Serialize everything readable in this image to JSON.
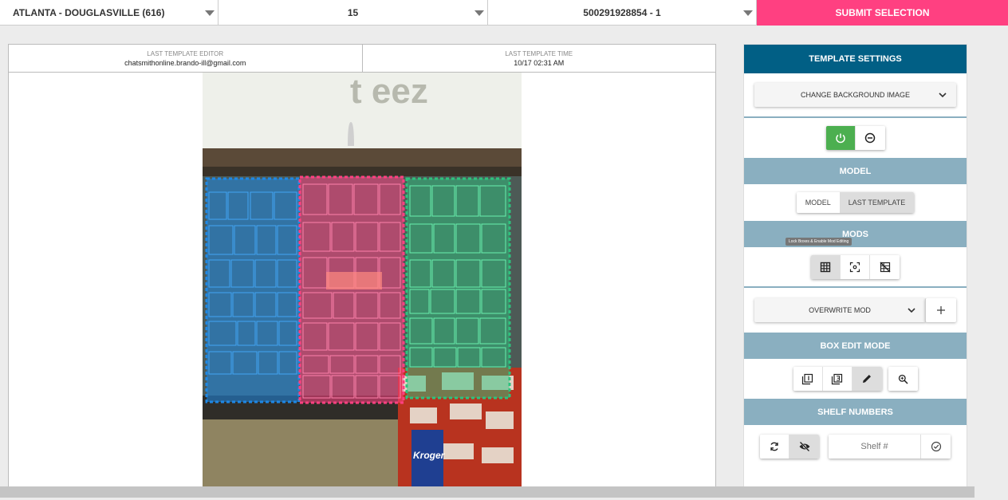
{
  "topbar": {
    "store": "ATLANTA - DOUGLASVILLE (616)",
    "number": "15",
    "id": "500291928854 - 1",
    "submit": "SUBMIT SELECTION"
  },
  "header": {
    "editor_label": "LAST TEMPLATE EDITOR",
    "editor_value": "chatsmithonline.brando-ill@gmail.com",
    "time_label": "LAST TEMPLATE TIME",
    "time_value": "10/17 02:31 AM"
  },
  "photo": {
    "sign_text": "t    eez",
    "cart_text": "Kroger",
    "zone_colors": [
      "#1e88e5",
      "#ff4081",
      "#2ec27e"
    ]
  },
  "panel": {
    "title": "TEMPLATE SETTINGS",
    "bg_dropdown": "CHANGE BACKGROUND IMAGE",
    "model_header": "MODEL",
    "model_tabs": [
      "MODEL",
      "LAST TEMPLATE"
    ],
    "model_selected": "LAST TEMPLATE",
    "mods_header": "MODS",
    "mods_tooltip": "Lock Boxes & Enable Mod Editing",
    "mod_dropdown": "OVERWRITE MOD",
    "box_header": "BOX EDIT MODE",
    "shelf_header": "SHELF NUMBERS",
    "shelf_placeholder": "Shelf #"
  },
  "colors": {
    "primary": "#015f85",
    "section": "#8aafc0",
    "accent": "#ff4081",
    "power": "#4caf50"
  }
}
